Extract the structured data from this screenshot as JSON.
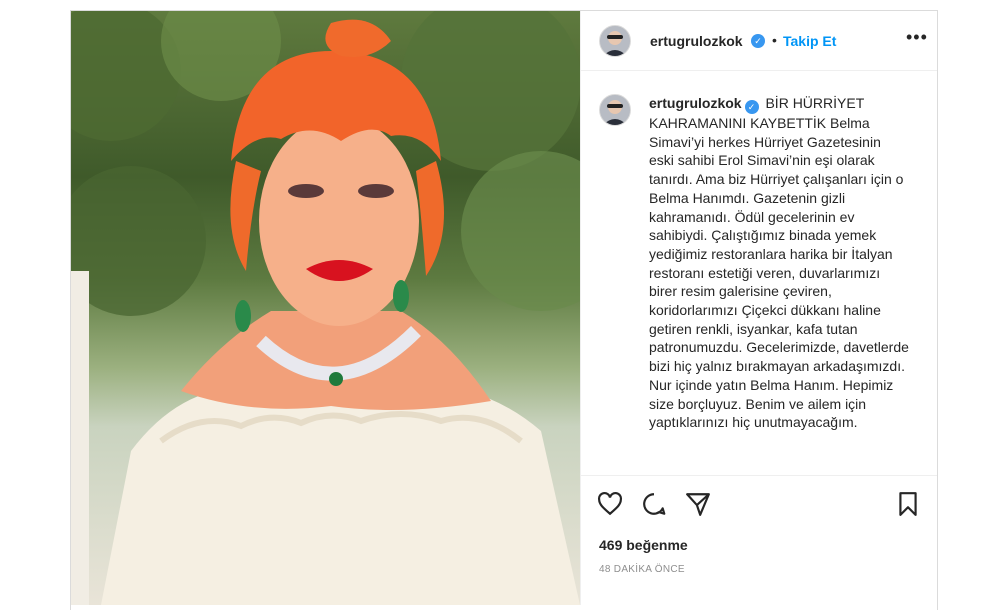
{
  "post": {
    "username": "ertugrulozkok",
    "follow_label": "Takip Et",
    "more_label": "•••",
    "caption": "BİR HÜRRİYET KAHRAMANINI KAYBETTİK Belma Simavi’yi herkes Hürriyet Gazetesinin eski sahibi Erol Simavi’nin eşi olarak tanırdı. Ama biz Hürriyet çalışanları için o Belma Hanımdı. Gazetenin gizli kahramanıdı. Ödül gecelerinin ev sahibiydi. Çalıştığımız binada yemek yediğimiz restoranlara harika bir İtalyan restoranı estetiği veren, duvarlarımızı birer resim galerisine çeviren, koridorlarımızı Çiçekci dükkanı haline getiren renkli, isyankar, kafa tutan patronumuzdu. Gecelerimizde, davetlerde bizi hiç yalnız bırakmayan arkadaşımızdı. Nur içinde yatın Belma Hanım. Hepimiz size borçluyuz. Benim ve ailem için yaptıklarınızı hiç unutmayacağım.",
    "likes": "469 beğenme",
    "time": "48 DAKİKA ÖNCE"
  },
  "icons": {
    "verified": "verified-badge-icon",
    "like": "heart-icon",
    "comment": "comment-icon",
    "share": "paper-plane-icon",
    "save": "bookmark-icon",
    "more": "more-dots-icon"
  },
  "colors": {
    "accent": "#0095f6",
    "verified": "#3897f0",
    "text": "#262626",
    "muted": "#8e8e8e",
    "border": "#dbdbdb"
  }
}
